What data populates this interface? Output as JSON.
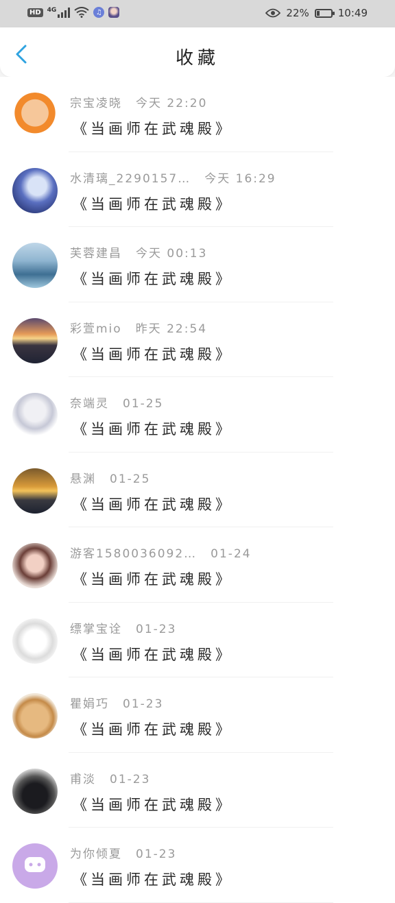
{
  "status": {
    "hd": "HD",
    "net": "4G",
    "battery_pct_text": "22%",
    "battery_level": 0.22,
    "time": "10:49"
  },
  "header": {
    "title": "收藏"
  },
  "colors": {
    "accent": "#2fa3e0",
    "text": "#2a2a2a",
    "muted": "#9a9a9a"
  },
  "items": [
    {
      "user": "宗宝凌晓",
      "time": "今天 22:20",
      "text": "《当画师在武魂殿》",
      "avatar": "cartoon-boy-avatar"
    },
    {
      "user": "水清璃_2290157…",
      "time": "今天 16:29",
      "text": "《当画师在武魂殿》",
      "avatar": "anime-girl-avatar"
    },
    {
      "user": "芙蓉建昌",
      "time": "今天 00:13",
      "text": "《当画师在武魂殿》",
      "avatar": "sea-girl-avatar"
    },
    {
      "user": "彩萱mio",
      "time": "昨天 22:54",
      "text": "《当画师在武魂殿》",
      "avatar": "sunset-avatar"
    },
    {
      "user": "奈端灵",
      "time": "01-25",
      "text": "《当画师在武魂殿》",
      "avatar": "anime-boy-avatar"
    },
    {
      "user": "悬渊",
      "time": "01-25",
      "text": "《当画师在武魂殿》",
      "avatar": "dusk-avatar"
    },
    {
      "user": "游客1580036092…",
      "time": "01-24",
      "text": "《当画师在武魂殿》",
      "avatar": "girl-photo-avatar"
    },
    {
      "user": "缥掌宝诠",
      "time": "01-23",
      "text": "《当画师在武魂殿》",
      "avatar": "sketch-girl-avatar"
    },
    {
      "user": "瞿娟巧",
      "time": "01-23",
      "text": "《当画师在武魂殿》",
      "avatar": "toast-avatar"
    },
    {
      "user": "甫淡",
      "time": "01-23",
      "text": "《当画师在武魂殿》",
      "avatar": "car-avatar"
    },
    {
      "user": "为你倾夏",
      "time": "01-23",
      "text": "《当画师在武魂殿》",
      "avatar": "default-chat-avatar"
    }
  ]
}
